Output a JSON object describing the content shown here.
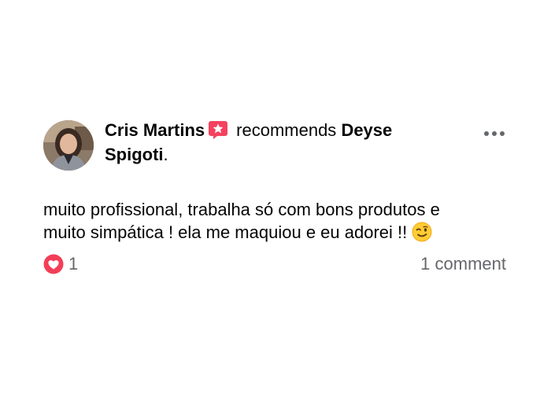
{
  "post": {
    "author": "Cris Martins",
    "action": "recommends",
    "target_line1": "Deyse",
    "target_line2": "Spigoti",
    "target_suffix": ".",
    "text_line1": "muito profissional, trabalha só com bons produtos e",
    "text_line2": "muito simpática ! ela me maquiou e eu adorei !!",
    "reaction_count": "1",
    "comment_count": "1 comment"
  },
  "icons": {
    "recommendation_badge": "recommendation-star-icon",
    "more_options": "more-options-icon",
    "emoji": "winking-face-emoji",
    "reaction": "love-reaction-icon"
  },
  "colors": {
    "badge": "#f3425f",
    "love": "#f33e58",
    "secondary_text": "#65676b",
    "primary_text": "#050505"
  }
}
